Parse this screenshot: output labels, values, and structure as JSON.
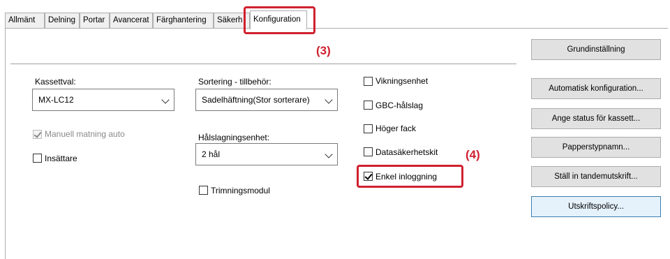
{
  "tabs": [
    {
      "label": "Allmänt"
    },
    {
      "label": "Delning"
    },
    {
      "label": "Portar"
    },
    {
      "label": "Avancerat"
    },
    {
      "label": "Färghantering"
    },
    {
      "label": "Säkerh"
    },
    {
      "label": "Konfiguration"
    }
  ],
  "active_tab": "Konfiguration",
  "left": {
    "kassettval_label": "Kassettval:",
    "kassettval_value": "MX-LC12",
    "manual_feed_label": "Manuell matning auto",
    "manual_feed_checked": true,
    "inserter_label": "Insättare",
    "inserter_checked": false
  },
  "middle": {
    "sorting_label": "Sortering - tillbehör:",
    "sorting_value": "Sadelhäftning(Stor sorterare)",
    "punch_label": "Hålslagningsenhet:",
    "punch_value": "2 hål",
    "trim_label": "Trimningsmodul",
    "trim_checked": false
  },
  "right": {
    "checkboxes": [
      {
        "label": "Vikningsenhet",
        "checked": false
      },
      {
        "label": "GBC-hålslag",
        "checked": false
      },
      {
        "label": "Höger fack",
        "checked": false
      },
      {
        "label": "Datasäkerhetskit",
        "checked": false
      },
      {
        "label": "Enkel inloggning",
        "checked": true
      }
    ]
  },
  "buttons": {
    "default": "Grundinställning",
    "auto_config": "Automatisk konfiguration...",
    "cassette_status": "Ange status för kassett...",
    "paper_type": "Papperstypnamn...",
    "tandem": "Ställ in tandemutskrift...",
    "print_policy": "Utskriftspolicy..."
  },
  "annotations": {
    "callout_3": "(3)",
    "callout_4": "(4)",
    "color": "#d0202f"
  }
}
